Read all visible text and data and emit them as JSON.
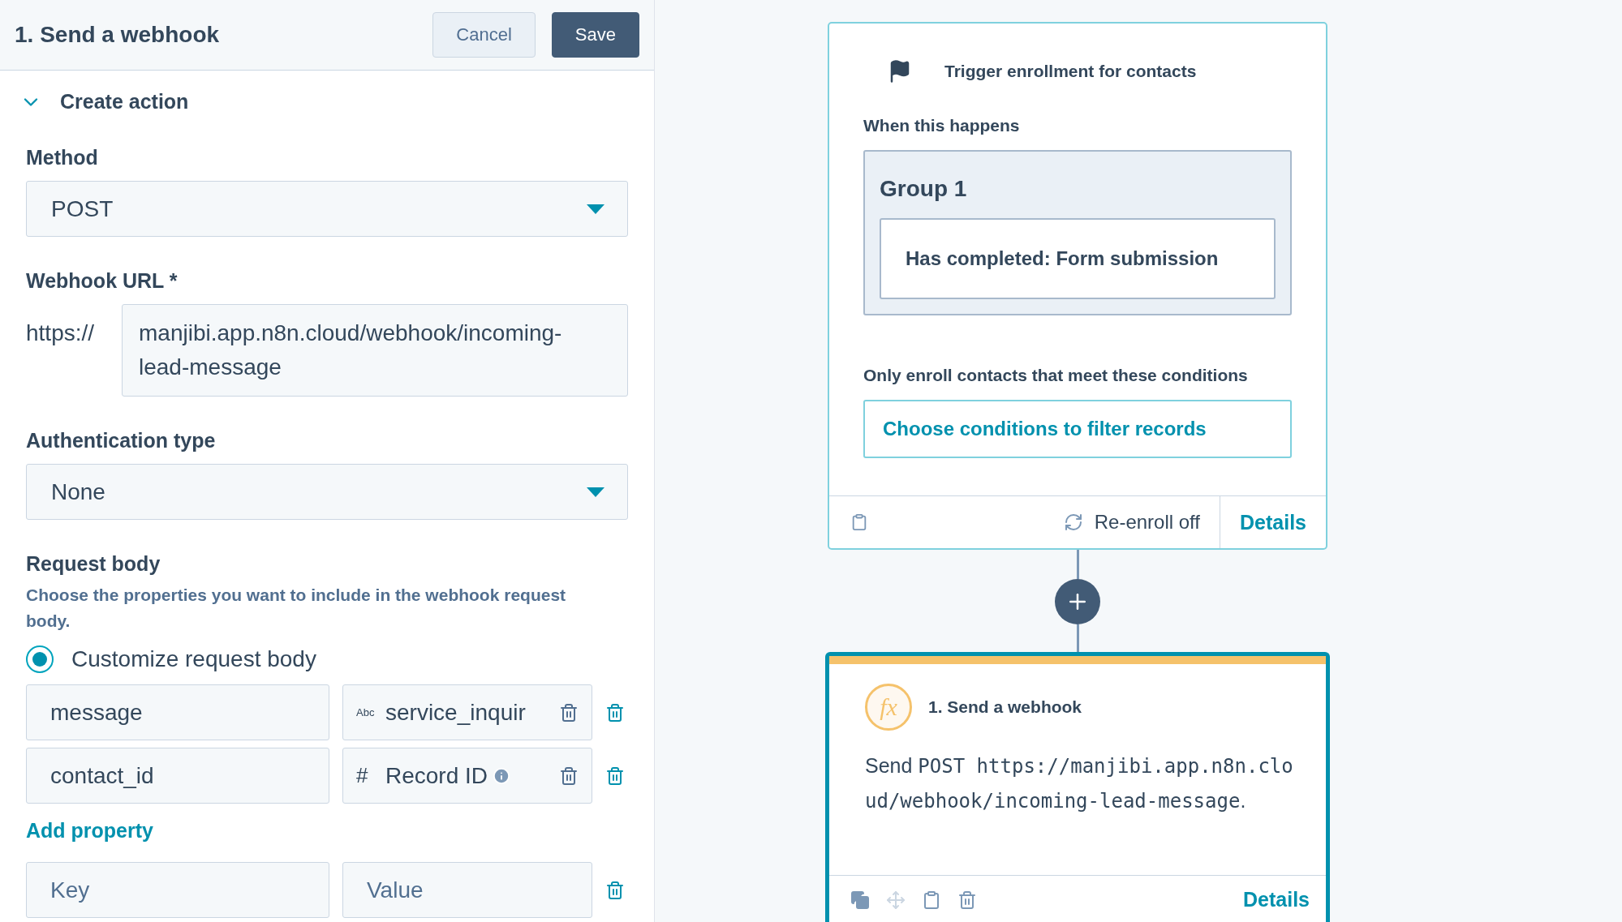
{
  "panel": {
    "title": "1. Send a webhook",
    "buttons": [
      {
        "label": "Cancel",
        "kind": "secondary"
      },
      {
        "label": "Save",
        "kind": "primary"
      }
    ]
  },
  "section": {
    "title": "Create action",
    "expanded": true
  },
  "method": {
    "label": "Method",
    "value": "POST"
  },
  "webhook_url": {
    "label": "Webhook URL *",
    "prefix": "https://",
    "value": "manjibi.app.n8n.cloud/webhook/incoming-lead-message"
  },
  "auth": {
    "label": "Authentication type",
    "value": "None"
  },
  "request_body": {
    "title": "Request body",
    "description": "Choose the properties you want to include in the webhook request body.",
    "option": {
      "label": "Customize request body",
      "selected": true
    },
    "properties": [
      {
        "key": "message",
        "type_badge": "Abc",
        "value": "service_inquir",
        "info": false
      },
      {
        "key": "contact_id",
        "type_badge": "#",
        "value": "Record ID",
        "info": true
      }
    ],
    "add_label": "Add property",
    "new_row": {
      "key_placeholder": "Key",
      "value_placeholder": "Value"
    }
  },
  "trigger": {
    "title": "Trigger enrollment for contacts",
    "when_label": "When this happens",
    "group": {
      "title": "Group 1",
      "conditions": [
        "Has completed: Form submission"
      ]
    },
    "filter_label": "Only enroll contacts that meet these conditions",
    "filter_button": "Choose conditions to filter records",
    "reenroll": "Re-enroll off",
    "details": "Details"
  },
  "action": {
    "title": "1. Send a webhook",
    "selected": true,
    "badge": "fx",
    "description": {
      "prefix": "Send",
      "method": "POST",
      "url": "https://manjibi.app.n8n.cloud/webhook/incoming-lead-message",
      "suffix": "."
    },
    "details": "Details"
  }
}
